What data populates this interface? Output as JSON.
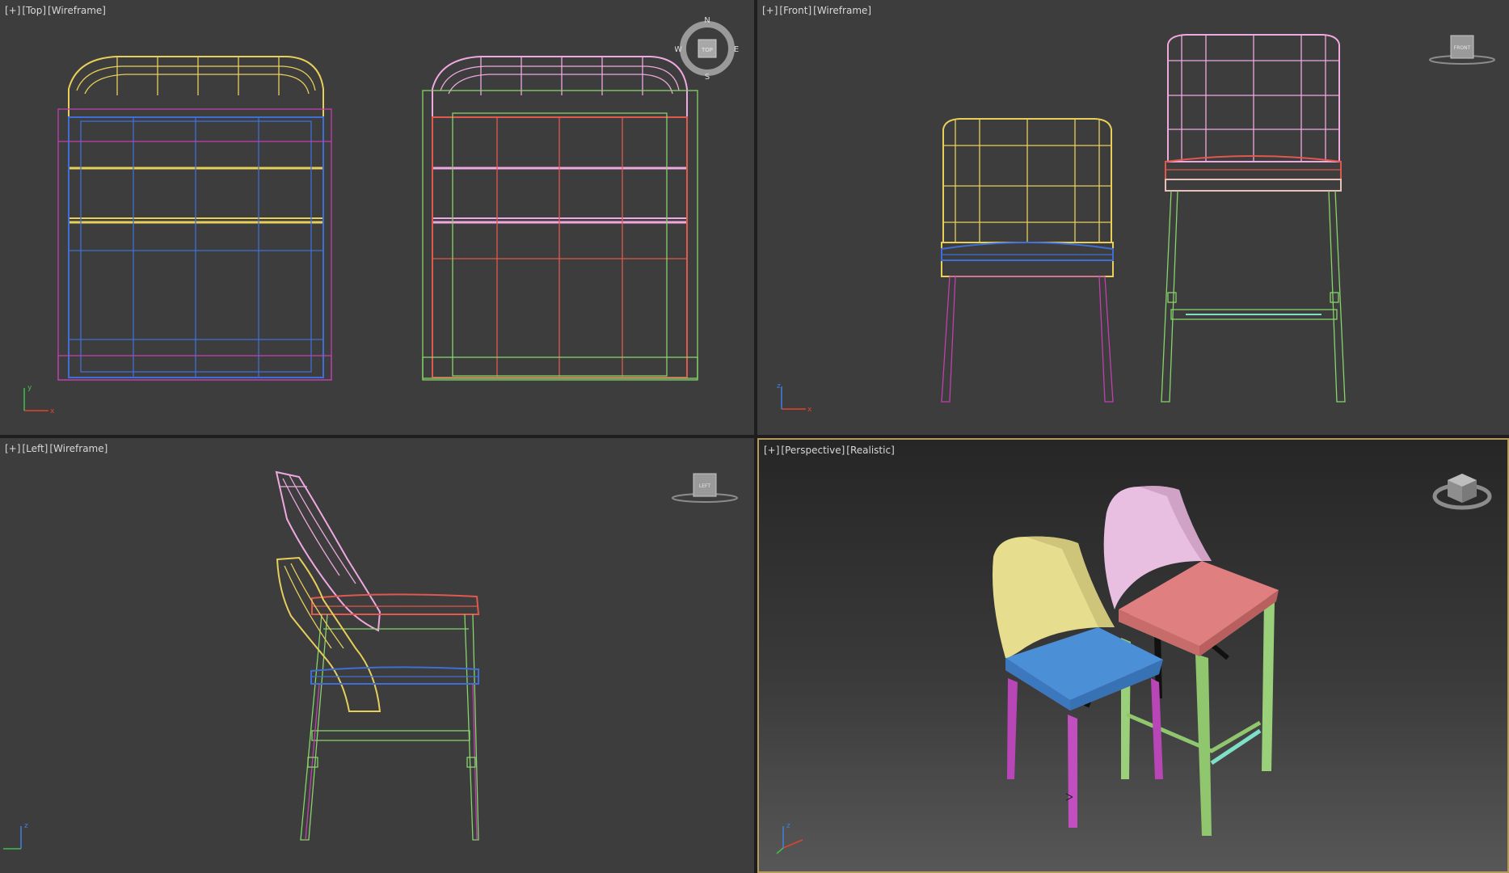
{
  "viewports": {
    "top": {
      "label": [
        "[+]",
        "[Top]",
        "[Wireframe]"
      ]
    },
    "front": {
      "label": [
        "[+]",
        "[Front]",
        "[Wireframe]"
      ]
    },
    "left": {
      "label": [
        "[+]",
        "[Left]",
        "[Wireframe]"
      ]
    },
    "persp": {
      "label": [
        "[+]",
        "[Perspective]",
        "[Realistic]"
      ]
    }
  },
  "viewcube": {
    "top_face": "TOP",
    "front_face": "FRONT",
    "left_face": "LEFT",
    "compass": {
      "n": "N",
      "s": "S",
      "e": "E",
      "w": "W"
    }
  },
  "axis": {
    "x": "x",
    "y": "y",
    "z": "z"
  },
  "colors": {
    "yellow": "#e8cf5a",
    "blue": "#3f6fd6",
    "magenta": "#c13fb0",
    "pink": "#f0a8e0",
    "red": "#e0584e",
    "green": "#86d46a",
    "cyan": "#7fe0c8",
    "accent_border": "#b49b5a"
  }
}
